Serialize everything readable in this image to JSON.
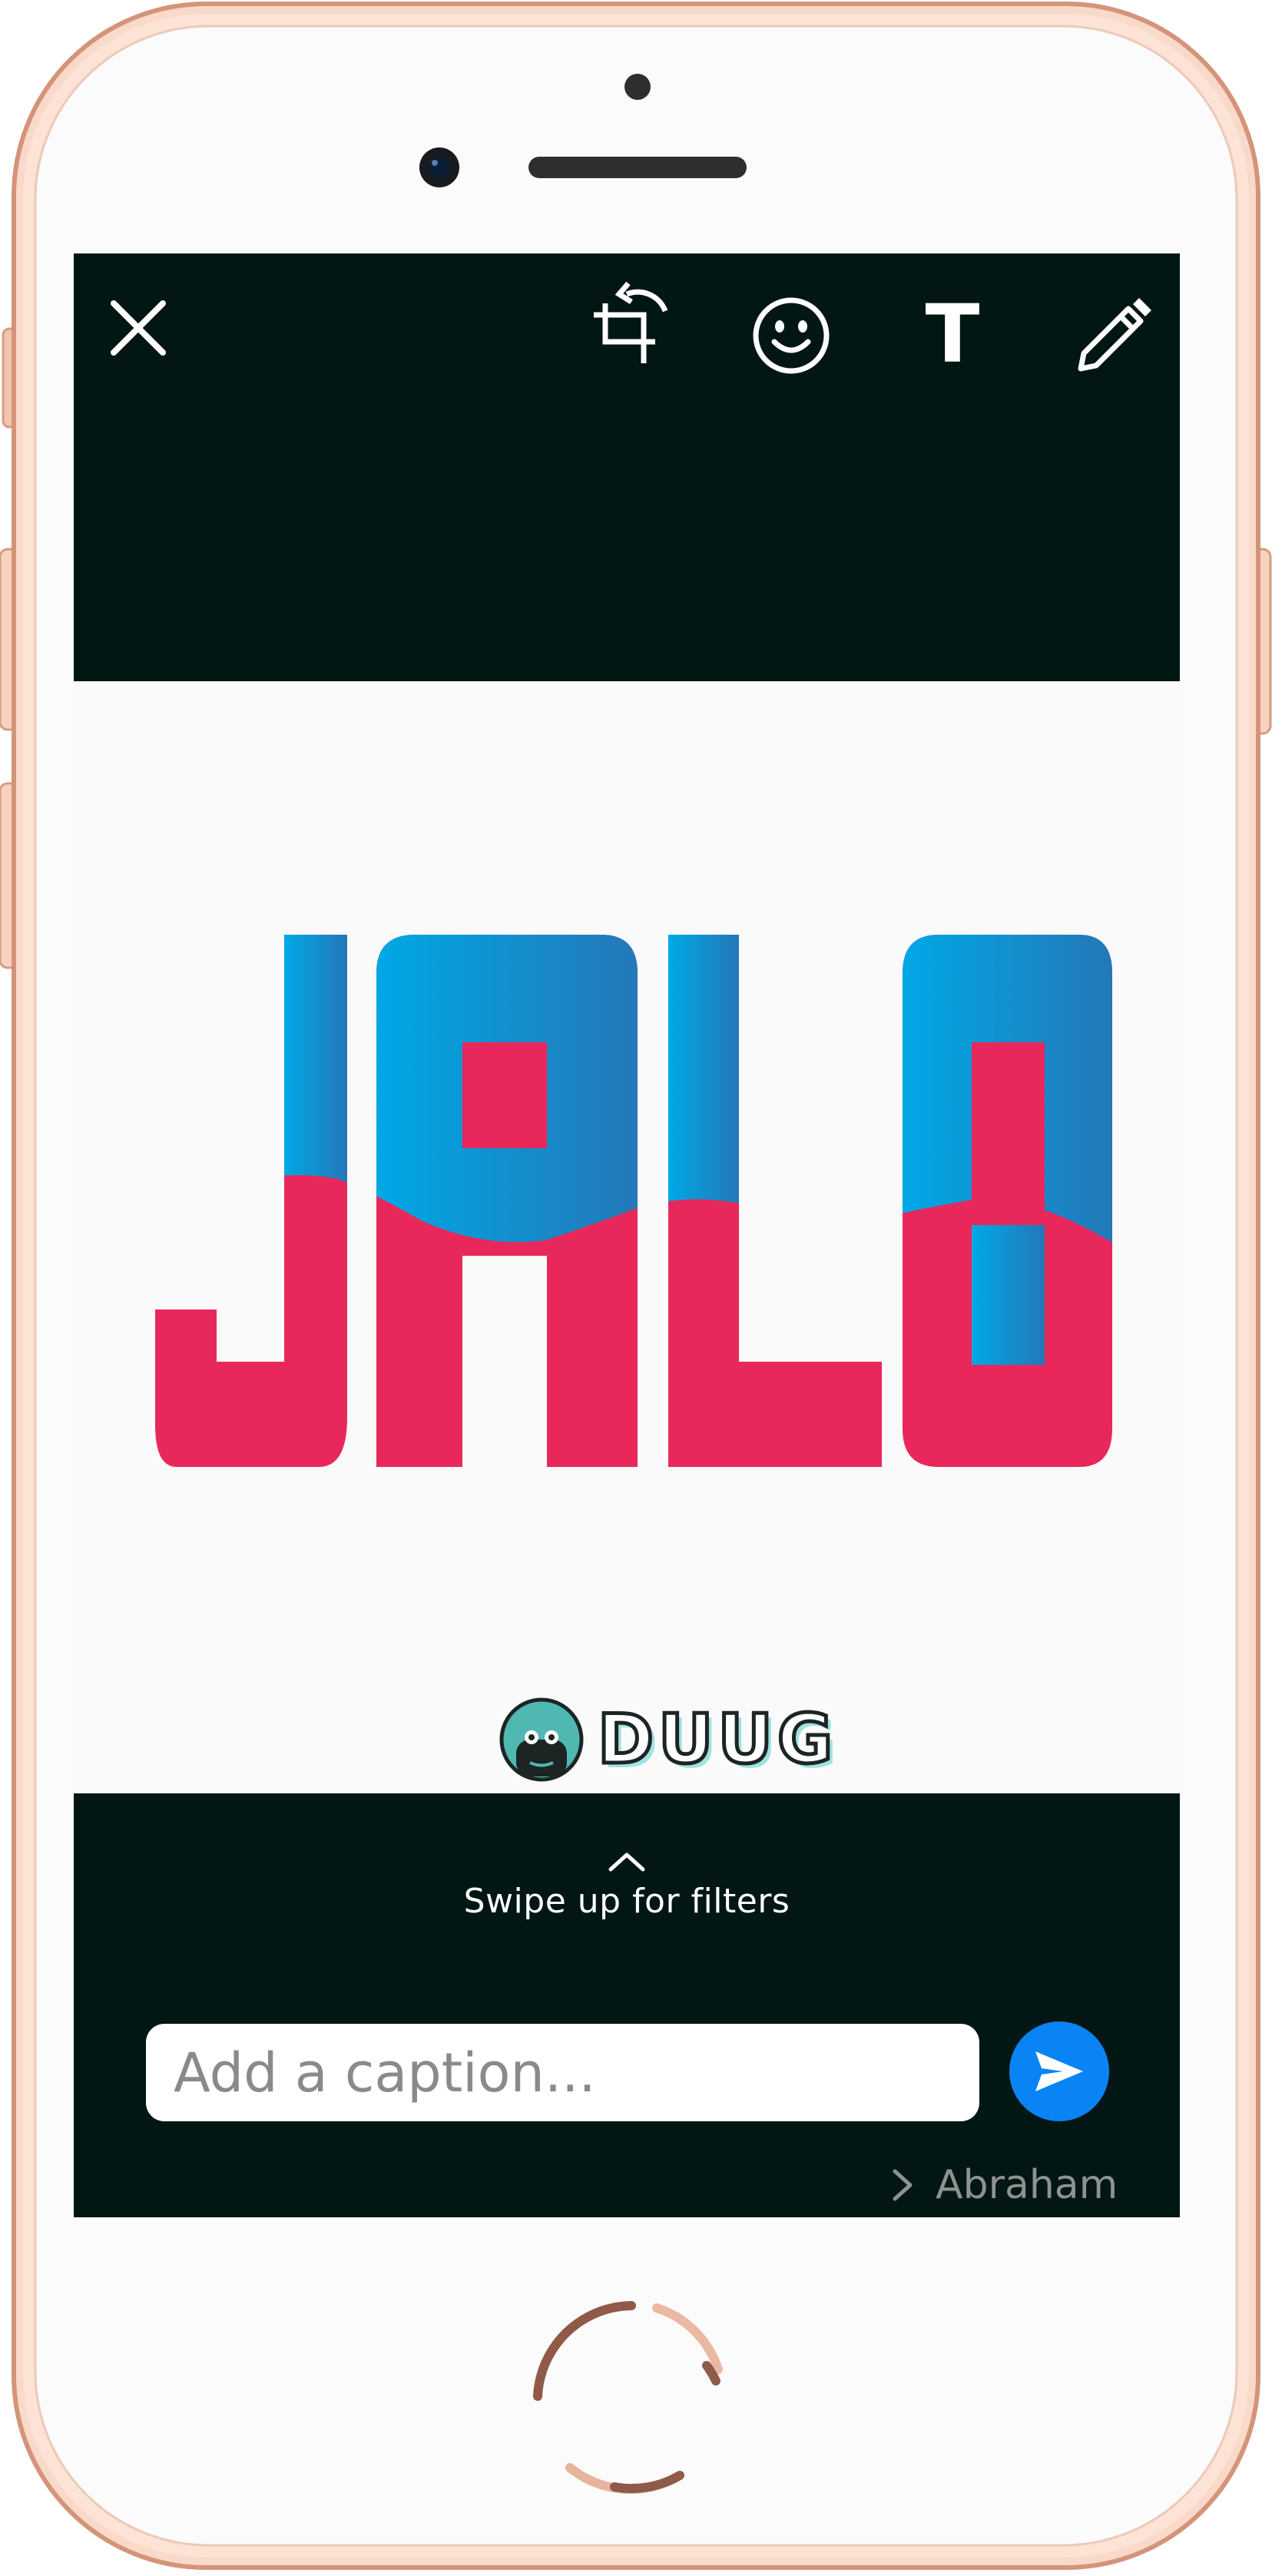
{
  "app": {
    "brand_colors": {
      "screen_dark": "#021614",
      "send_accent": "#0a84f5",
      "phone_frame": "#f4c9b4"
    }
  },
  "toolbar": {
    "icons": [
      "close-icon",
      "crop-rotate-icon",
      "emoji-icon",
      "text-icon",
      "pencil-icon"
    ],
    "text_tool_glyph": "T"
  },
  "image": {
    "logo_text": "JALO",
    "logo_colors": {
      "top_gradient_start": "#00a8e6",
      "top_gradient_end": "#2478b8",
      "bottom": "#e8285a"
    },
    "watermark_text": "DUUG"
  },
  "filters": {
    "hint": "Swipe up for filters"
  },
  "caption": {
    "placeholder": "Add a caption..."
  },
  "recipient": {
    "name": "Abraham"
  }
}
